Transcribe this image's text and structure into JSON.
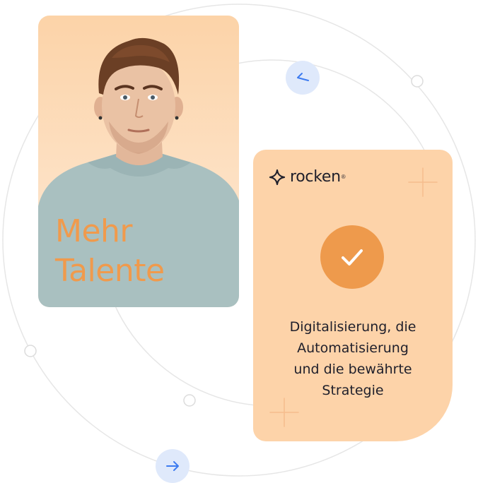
{
  "headline": {
    "line1": "Mehr",
    "line2": "Talente"
  },
  "brand": {
    "name": "rocken",
    "registered": "®"
  },
  "info": {
    "lines": [
      "Digitalisierung, die",
      "Automatisierung",
      "und die bewährte",
      "Strategie"
    ]
  },
  "icons": {
    "check": "check-icon",
    "prev": "arrow-left-icon",
    "next": "arrow-right-icon",
    "logo": "sparkle-logo-icon"
  },
  "colors": {
    "peach": "#fdd3a9",
    "orange": "#ee9a4c",
    "headline": "#f09a4c",
    "text": "#1f1f2b",
    "nav_bg": "#dfe9fb",
    "nav_arrow": "#3d7bf0",
    "orbit": "#e6e6e6"
  }
}
